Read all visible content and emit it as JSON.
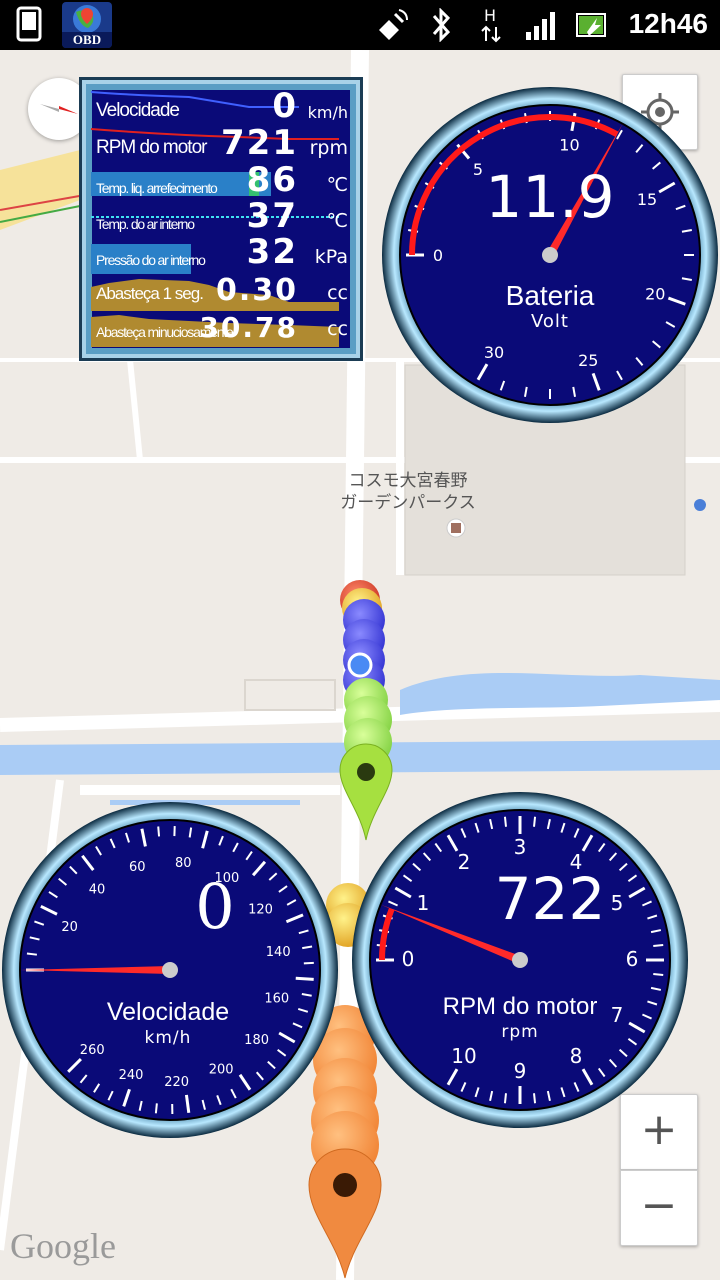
{
  "status_bar": {
    "time": "12h46",
    "icons": [
      "phone-icon",
      "obd-app-icon",
      "gps-icon",
      "bluetooth-icon",
      "h-network-icon",
      "signal-icon",
      "battery-charging-icon"
    ],
    "obd_logo_text": "OBD"
  },
  "map": {
    "poi_name_line1": "コスモ大宮春野",
    "poi_name_line2": "ガーデンパークス",
    "attribution": "Google"
  },
  "panel": {
    "rows": [
      {
        "label": "Velocidade",
        "value": "0",
        "unit": "km/h"
      },
      {
        "label": "RPM do motor",
        "value": "721",
        "unit": "rpm"
      },
      {
        "label": "Temp. liq. arrefecimento",
        "value": "86",
        "unit": "℃"
      },
      {
        "label": "Temp. do ar interno",
        "value": "37",
        "unit": "℃"
      },
      {
        "label": "Pressão do ar interno",
        "value": "32",
        "unit": "kPa"
      },
      {
        "label": "Abasteça 1 seg.",
        "value": "0.30",
        "unit": "cc"
      },
      {
        "label": "Abasteça minuciosamente",
        "value": "30.78",
        "unit": "cc"
      }
    ]
  },
  "gauges": {
    "battery": {
      "value": "11.9",
      "label": "Bateria",
      "unit": "Volt",
      "ticks": [
        "0",
        "5",
        "10",
        "15",
        "20",
        "25",
        "30"
      ],
      "reading": 11.9
    },
    "speed": {
      "value": "0",
      "label": "Velocidade",
      "unit": "km/h",
      "ticks": [
        "20",
        "40",
        "60",
        "80",
        "100",
        "120",
        "140",
        "160",
        "180",
        "200",
        "220",
        "240",
        "260"
      ],
      "reading": 0
    },
    "rpm": {
      "value": "722",
      "label": "RPM do motor",
      "unit": "rpm",
      "ticks": [
        "0",
        "1",
        "2",
        "3",
        "4",
        "5",
        "6",
        "7",
        "8",
        "9",
        "10"
      ],
      "reading": 722
    }
  },
  "controls": {
    "zoom_in": "+",
    "zoom_out": "−"
  },
  "colors": {
    "gauge_face": "#0a0a78",
    "needle": "#ff2020",
    "panel_bg": "#0a0a78",
    "water": "#aaccf5",
    "road": "#ffffff"
  }
}
